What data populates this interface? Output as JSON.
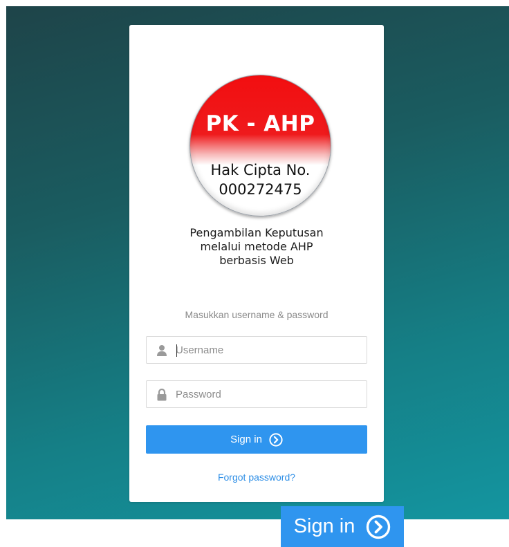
{
  "logo": {
    "title": "PK - AHP",
    "line1": "Hak Cipta No.",
    "line2": "000272475"
  },
  "app": {
    "desc_line1": "Pengambilan Keputusan",
    "desc_line2": "melalui metode AHP",
    "desc_line3": "berbasis Web"
  },
  "login": {
    "prompt": "Masukkan username & password",
    "username_placeholder": "Username",
    "username_value": "",
    "password_placeholder": "Password",
    "password_value": "",
    "signin_label": "Sign in",
    "forgot_label": "Forgot password?"
  },
  "zoom": {
    "signin_label": "Sign in"
  },
  "colors": {
    "accent": "#2f95ef",
    "link": "#2f8fe6",
    "logo_red": "#f20e10"
  },
  "icons": {
    "username": "user-icon",
    "password": "lock-icon",
    "signin": "chevron-circle-right-icon"
  }
}
